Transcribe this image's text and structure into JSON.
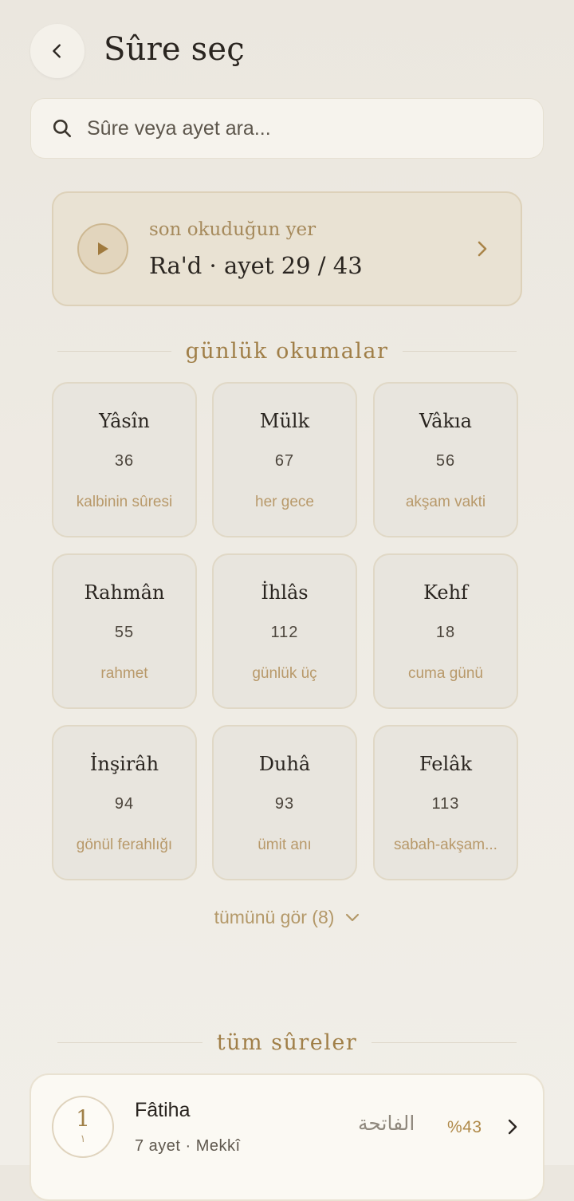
{
  "header": {
    "title": "Sûre seç"
  },
  "search": {
    "placeholder": "Sûre veya ayet ara..."
  },
  "continue_reading": {
    "label": "son okuduğun yer",
    "value": "Ra'd · ayet 29 / 43"
  },
  "daily": {
    "title": "günlük okumalar",
    "items": [
      {
        "name": "Yâsîn",
        "number": "36",
        "note": "kalbinin sûresi"
      },
      {
        "name": "Mülk",
        "number": "67",
        "note": "her gece"
      },
      {
        "name": "Vâkıa",
        "number": "56",
        "note": "akşam vakti"
      },
      {
        "name": "Rahmân",
        "number": "55",
        "note": "rahmet"
      },
      {
        "name": "İhlâs",
        "number": "112",
        "note": "günlük üç"
      },
      {
        "name": "Kehf",
        "number": "18",
        "note": "cuma günü"
      },
      {
        "name": "İnşirâh",
        "number": "94",
        "note": "gönül ferahlığı"
      },
      {
        "name": "Duhâ",
        "number": "93",
        "note": "ümit anı"
      },
      {
        "name": "Felâk",
        "number": "113",
        "note": "sabah-akşam..."
      }
    ],
    "see_all": "tümünü gör (8)"
  },
  "all_surahs": {
    "title": "tüm sûreler",
    "items": [
      {
        "number": "1",
        "arabic_number": "١",
        "name": "Fâtiha",
        "meta": "7 ayet · Mekkî",
        "arabic": "الفاتحة",
        "progress": "%43"
      }
    ]
  },
  "colors": {
    "accent": "#a07f48",
    "background": "#ece8e0",
    "card": "#fbf9f3"
  },
  "icons": [
    "chevron-left-icon",
    "search-icon",
    "play-icon",
    "chevron-right-icon",
    "chevron-down-icon"
  ]
}
